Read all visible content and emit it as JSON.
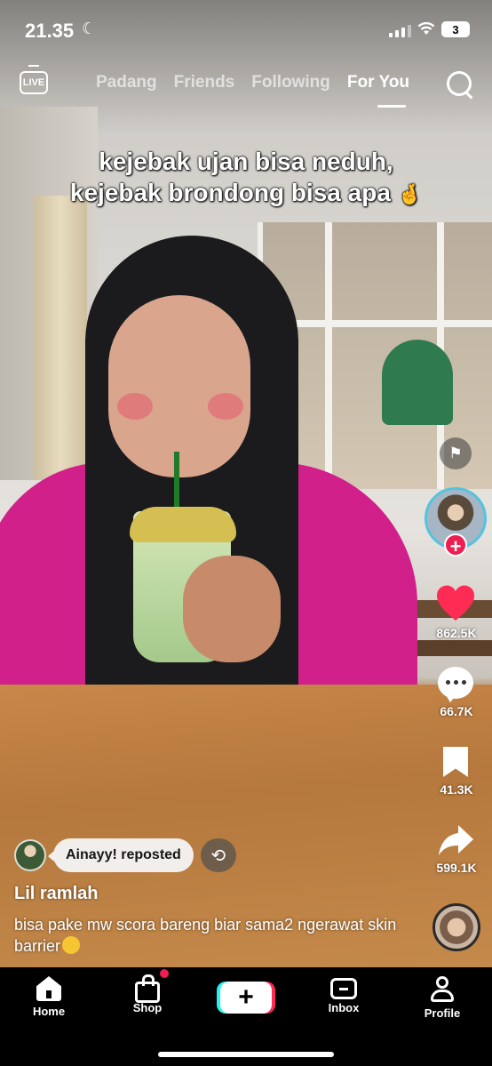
{
  "status_bar": {
    "time": "21.35",
    "battery": "3"
  },
  "top_nav": {
    "live_label": "LIVE",
    "tabs": [
      {
        "label": "Padang",
        "active": false
      },
      {
        "label": "Friends",
        "active": false
      },
      {
        "label": "Following",
        "active": false
      },
      {
        "label": "For You",
        "active": true
      }
    ]
  },
  "video": {
    "caption_line1": "kejebak ujan bisa neduh,",
    "caption_line2": "kejebak brondong bisa apa"
  },
  "actions": {
    "likes": "862.5K",
    "comments": "66.7K",
    "saves": "41.3K",
    "shares": "599.1K",
    "follow_symbol": "+"
  },
  "post": {
    "repost_label": "Ainayy! reposted",
    "username": "Lil ramlah",
    "description": "bisa pake mw scora bareng biar sama2 ngerawat skin barrier"
  },
  "bottom_nav": {
    "items": [
      {
        "label": "Home"
      },
      {
        "label": "Shop"
      },
      {
        "label": ""
      },
      {
        "label": "Inbox"
      },
      {
        "label": "Profile"
      }
    ],
    "create_symbol": "+"
  },
  "colors": {
    "accent_red": "#ee1d52",
    "accent_cyan": "#25f4ee",
    "like_red": "#fe2c55"
  },
  "icons": [
    "live-icon",
    "search-icon",
    "flag-icon",
    "heart-icon",
    "comment-icon",
    "bookmark-icon",
    "share-icon",
    "repost-icon",
    "home-icon",
    "shop-icon",
    "inbox-icon",
    "profile-icon"
  ]
}
